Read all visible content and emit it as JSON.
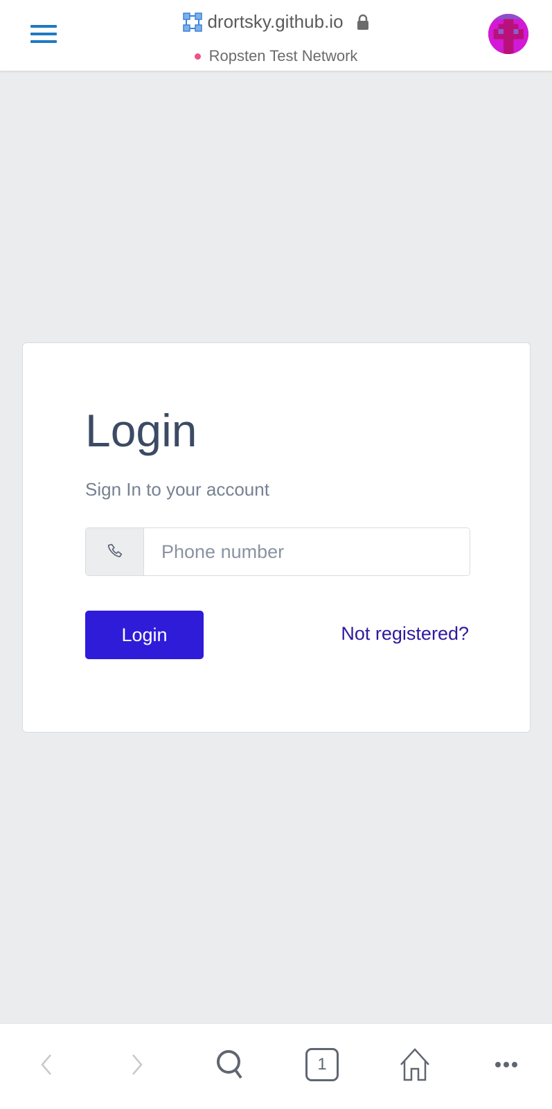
{
  "browser": {
    "domain": "drortsky.github.io",
    "network": "Ropsten Test Network",
    "tab_count": "1"
  },
  "login": {
    "title": "Login",
    "subtitle": "Sign In to your account",
    "phone_placeholder": "Phone number",
    "phone_value": "",
    "login_button": "Login",
    "register_link": "Not registered?"
  },
  "colors": {
    "accent": "#2e1cd9",
    "link": "#2e1a9e",
    "menu": "#1f7ac1",
    "network_dot": "#f0508a"
  }
}
